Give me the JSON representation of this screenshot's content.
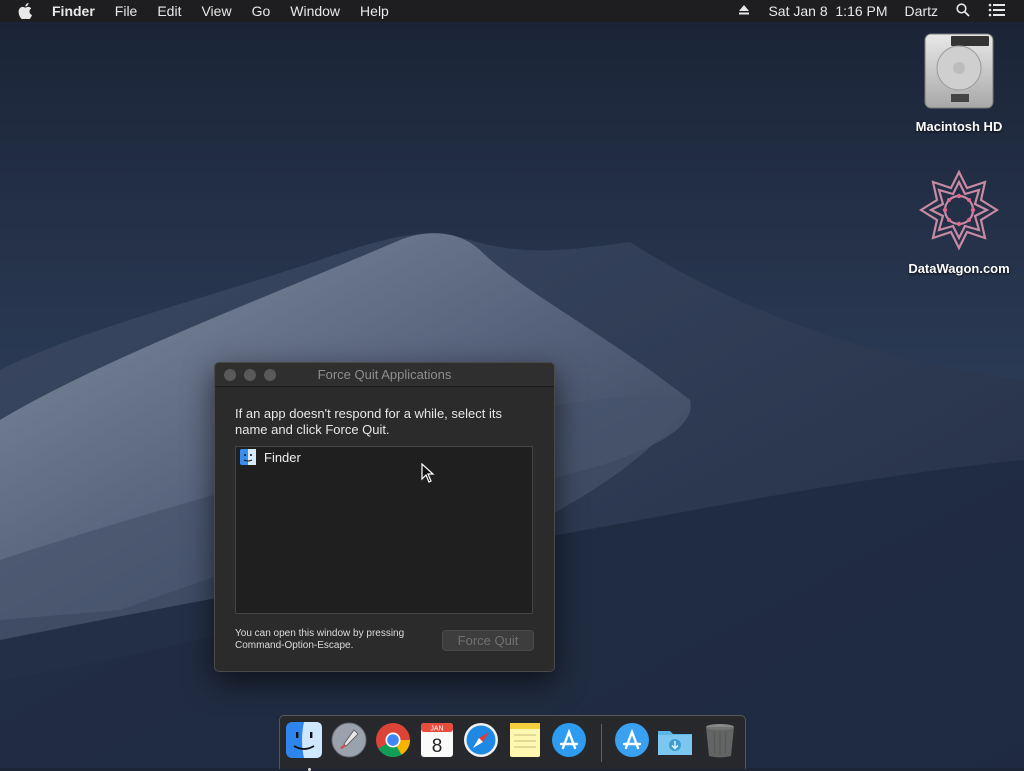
{
  "menubar": {
    "app_name": "Finder",
    "items": [
      "File",
      "Edit",
      "View",
      "Go",
      "Window",
      "Help"
    ],
    "clock": "Sat Jan 8  1:16 PM",
    "user": "Dartz",
    "icons": [
      "apple-icon",
      "eject-icon",
      "spotlight-search-icon",
      "notification-center-icon"
    ]
  },
  "desktop": {
    "icons": [
      {
        "label": "Macintosh HD",
        "icon": "hard-drive-icon"
      },
      {
        "label": "DataWagon.com",
        "icon": "datawagon-logo-icon"
      }
    ]
  },
  "force_quit_window": {
    "title": "Force Quit Applications",
    "instructions": "If an app doesn't respond for a while, select its name and click Force Quit.",
    "apps": [
      {
        "name": "Finder",
        "icon": "finder-icon"
      }
    ],
    "hint_line1": "You can open this window by pressing",
    "hint_line2": "Command-Option-Escape.",
    "button_label": "Force Quit",
    "button_enabled": false
  },
  "dock": {
    "items": [
      {
        "name": "Finder",
        "icon": "finder-icon",
        "running": true
      },
      {
        "name": "Launchpad",
        "icon": "launchpad-icon"
      },
      {
        "name": "Google Chrome",
        "icon": "chrome-icon"
      },
      {
        "name": "Calendar",
        "icon": "calendar-icon",
        "month": "JAN",
        "day": "8"
      },
      {
        "name": "Safari",
        "icon": "safari-icon"
      },
      {
        "name": "Notes",
        "icon": "notes-icon"
      },
      {
        "name": "App Store",
        "icon": "app-store-icon"
      },
      {
        "name": "Applications",
        "icon": "applications-folder-icon"
      },
      {
        "name": "Downloads",
        "icon": "downloads-folder-icon"
      },
      {
        "name": "Trash",
        "icon": "trash-icon"
      }
    ]
  }
}
